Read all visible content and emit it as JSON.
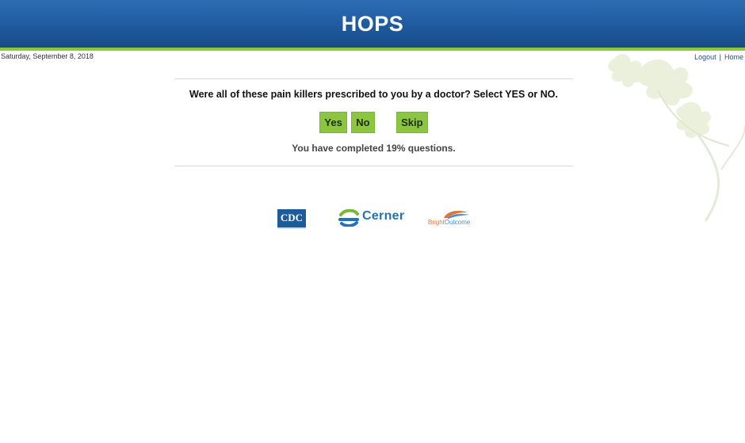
{
  "header": {
    "title": "HOPS",
    "brand_color": "#1f5a9e",
    "accent_color": "#8cc63f"
  },
  "date_text": "Saturday, September 8, 2018",
  "nav": {
    "logout_label": "Logout",
    "separator": "|",
    "home_label": "Home"
  },
  "question": {
    "text": "Were all of these pain killers prescribed to you by a doctor? Select YES or NO.",
    "yes_label": "Yes",
    "no_label": "No",
    "skip_label": "Skip"
  },
  "progress": {
    "text": "You have completed 19% questions.",
    "percent": 19
  },
  "logos": {
    "cdc": "CDC",
    "cerner": "Cerner",
    "bright_part1": "Bright",
    "bright_part2": "Outcome"
  },
  "icons": [
    "leaf-decoration-icon",
    "cdc-logo-icon",
    "cerner-logo-icon",
    "brightoutcome-logo-icon"
  ]
}
